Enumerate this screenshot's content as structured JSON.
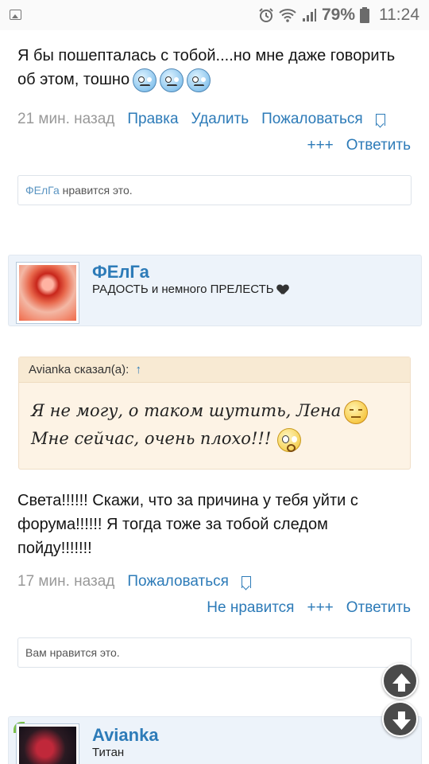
{
  "status_bar": {
    "battery": "79%",
    "time": "11:24"
  },
  "post1": {
    "text": "Я бы пошепталась с тобой....но мне даже говорить об этом, тошно",
    "time_ago": "21 мин. назад",
    "links": [
      "Правка",
      "Удалить",
      "Пожаловаться"
    ],
    "actions": [
      "+++",
      "Ответить"
    ],
    "likes_user": "ФЕлГа",
    "likes_text": " нравится это."
  },
  "user1": {
    "name": "ФЕлГа",
    "title": "РАДОСТЬ и немного ПРЕЛЕСТЬ"
  },
  "quote": {
    "author_line": "Avianka сказал(а):",
    "arrow": "↑",
    "text_part1": "Я не могу, о таком шутить, Лена",
    "text_part2": "Мне сейчас, очень плохо!!!"
  },
  "post2": {
    "text": "Света!!!!!! Скажи, что за причина у тебя уйти с форума!!!!!! Я тогда тоже за тобой следом пойду!!!!!!!",
    "time_ago": "17 мин. назад",
    "links": [
      "Пожаловаться"
    ],
    "actions": [
      "Не нравится",
      "+++",
      "Ответить"
    ],
    "likes_text": "Вам нравится это."
  },
  "user2": {
    "name": "Avianka",
    "title": "Титан"
  },
  "icons": {
    "scroll_up": "arrow-up-icon",
    "scroll_down": "arrow-down-icon"
  }
}
